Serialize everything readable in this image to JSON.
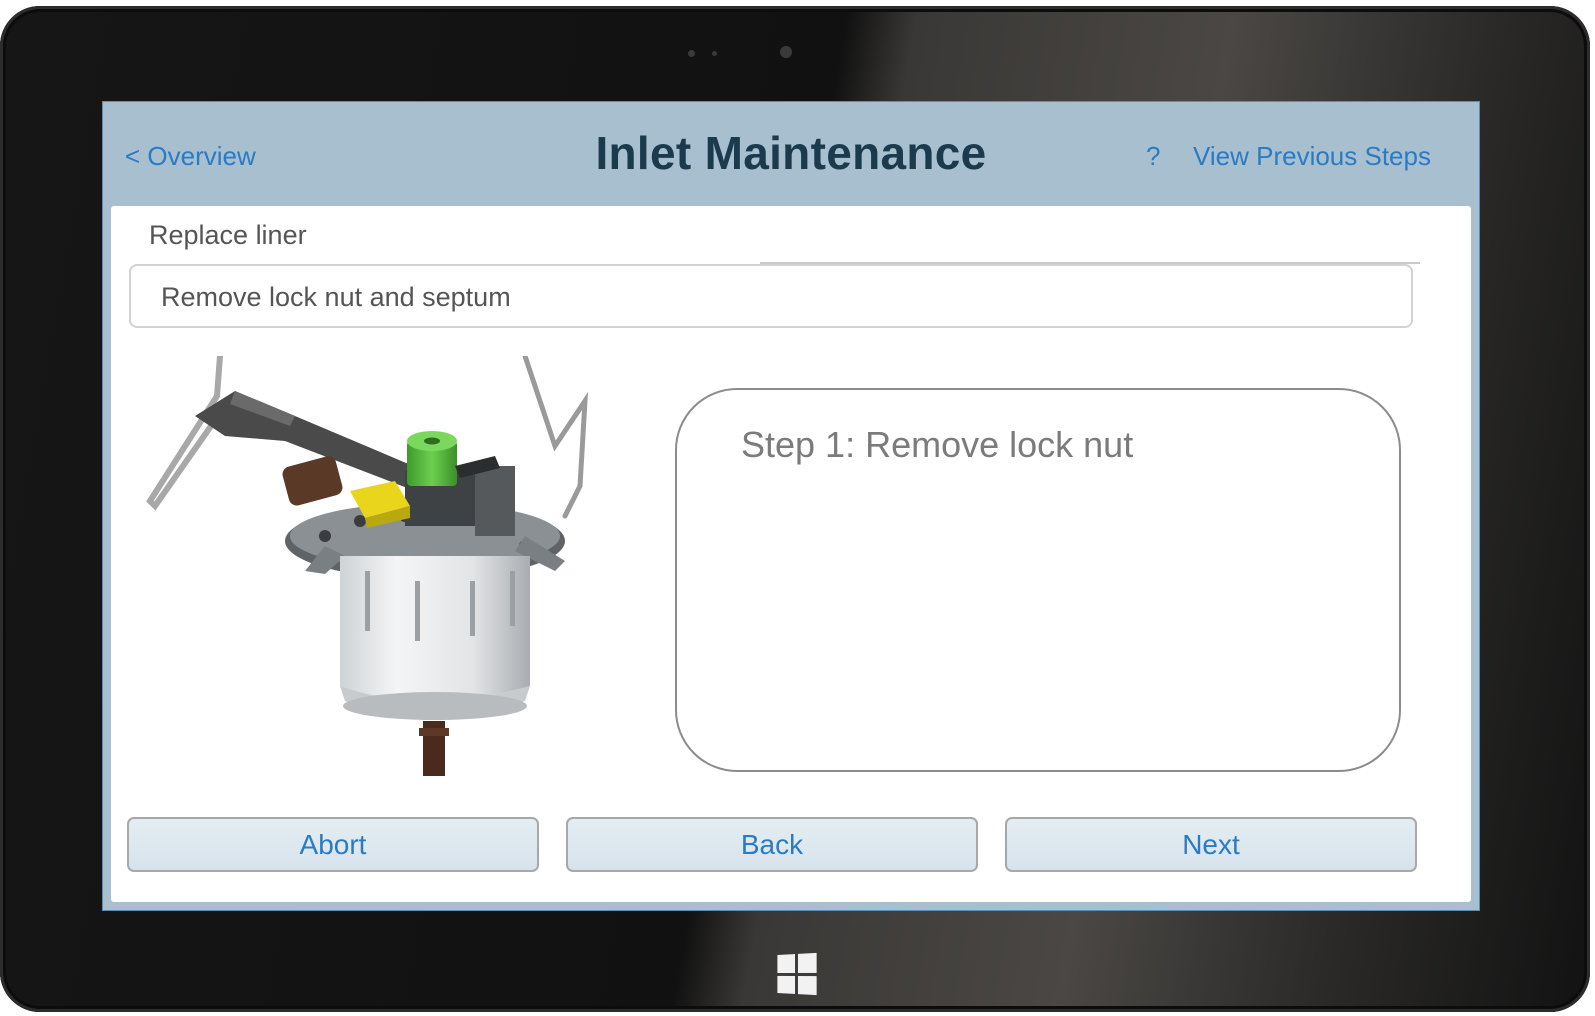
{
  "header": {
    "back_link": "< Overview",
    "title": "Inlet Maintenance",
    "help": "?",
    "previous_steps_link": "View Previous Steps"
  },
  "procedure": {
    "section": "Replace liner",
    "step_title": "Remove lock nut and septum",
    "instruction": "Step 1: Remove lock nut"
  },
  "buttons": {
    "abort": "Abort",
    "back": "Back",
    "next": "Next"
  },
  "illustration": {
    "icon": "inlet-assembly-illustration"
  },
  "colors": {
    "screen_header": "#a8bfcf",
    "link_blue": "#2a7bc4",
    "title": "#1c3a4e",
    "lock_nut_green": "#52b33b",
    "part_yellow": "#e8d51c"
  }
}
